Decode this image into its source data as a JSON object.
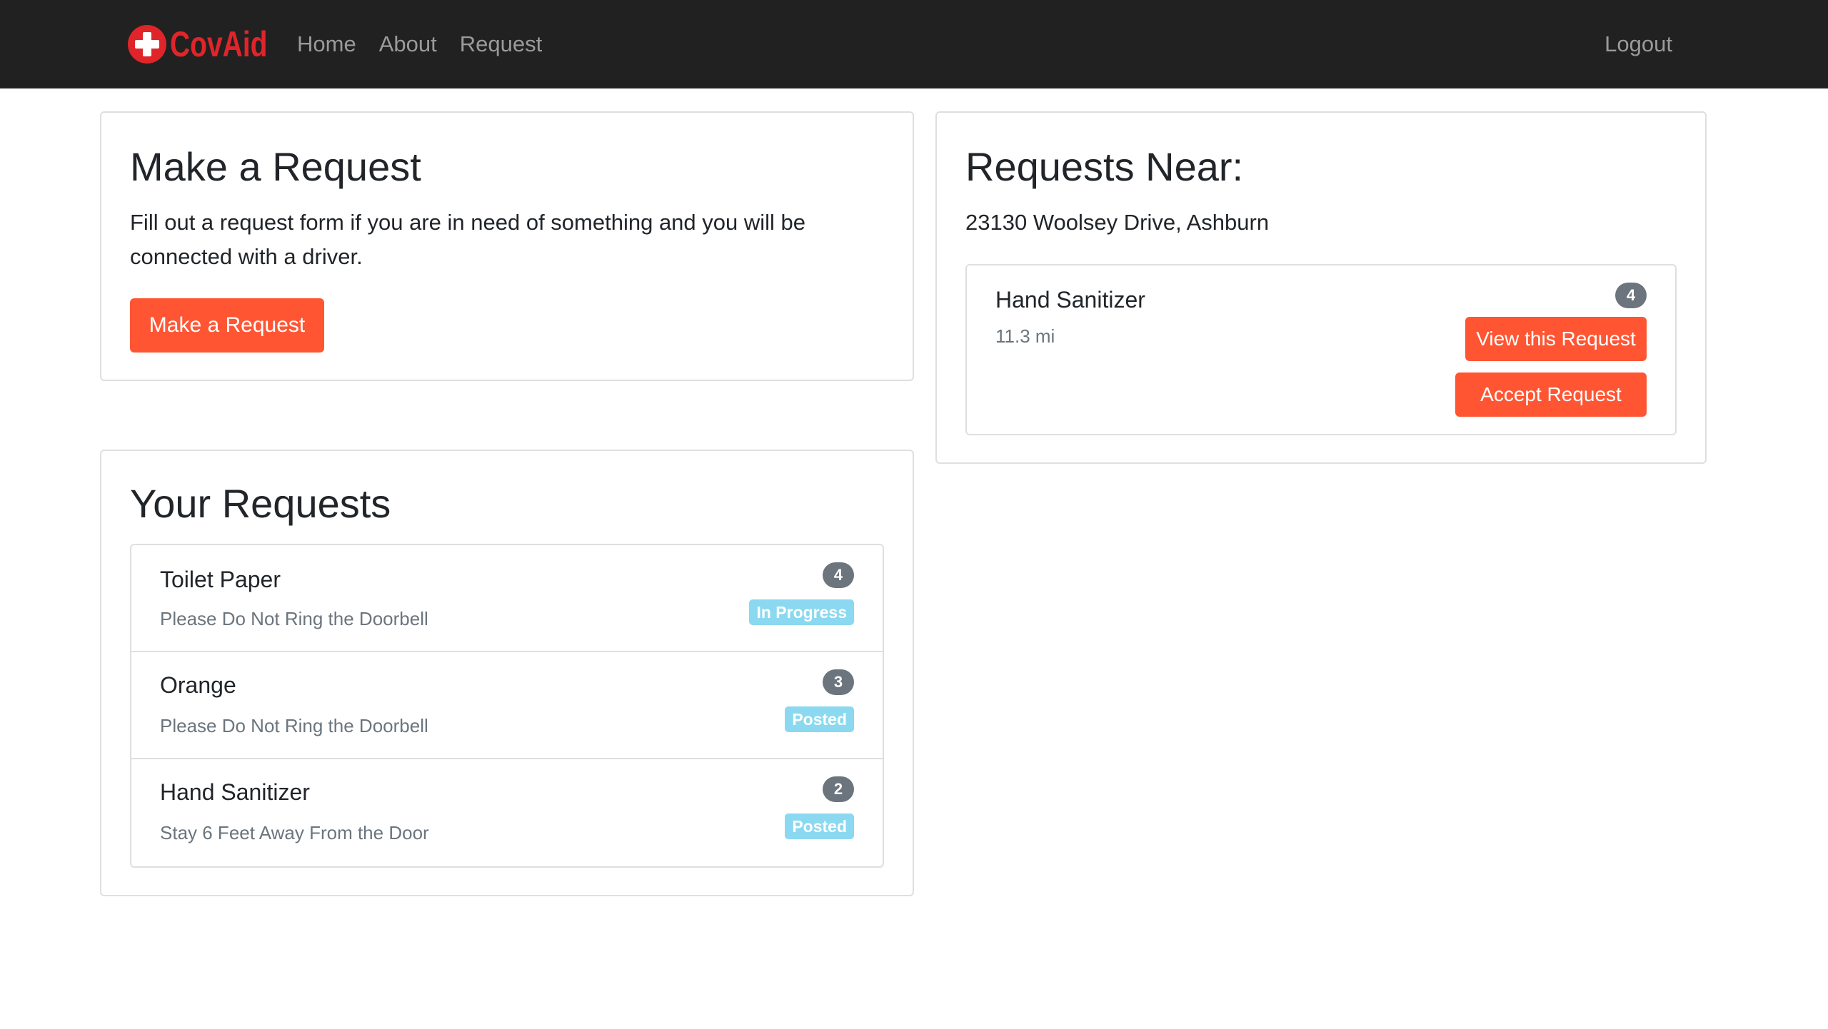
{
  "nav": {
    "brand": "CovAid",
    "links": [
      "Home",
      "About",
      "Request"
    ],
    "logout": "Logout"
  },
  "make_request": {
    "title": "Make a Request",
    "text": "Fill out a request form if you are in need of something and you will be connected with a driver.",
    "button": "Make a Request"
  },
  "your_requests": {
    "title": "Your Requests",
    "items": [
      {
        "title": "Toilet Paper",
        "note": "Please Do Not Ring the Doorbell",
        "count": "4",
        "status": "In Progress"
      },
      {
        "title": "Orange",
        "note": "Please Do Not Ring the Doorbell",
        "count": "3",
        "status": "Posted"
      },
      {
        "title": "Hand Sanitizer",
        "note": "Stay 6 Feet Away From the Door",
        "count": "2",
        "status": "Posted"
      }
    ]
  },
  "requests_near": {
    "title": "Requests Near:",
    "address": "23130 Woolsey Drive, Ashburn",
    "items": [
      {
        "title": "Hand Sanitizer",
        "distance": "11.3 mi",
        "count": "4",
        "view_label": "View this Request",
        "accept_label": "Accept Request"
      }
    ]
  },
  "colors": {
    "accent": "#ff5533",
    "brand": "#e0252a",
    "navbar": "#212121",
    "info_badge": "#8ad9f0",
    "count_badge": "#6c757d"
  }
}
